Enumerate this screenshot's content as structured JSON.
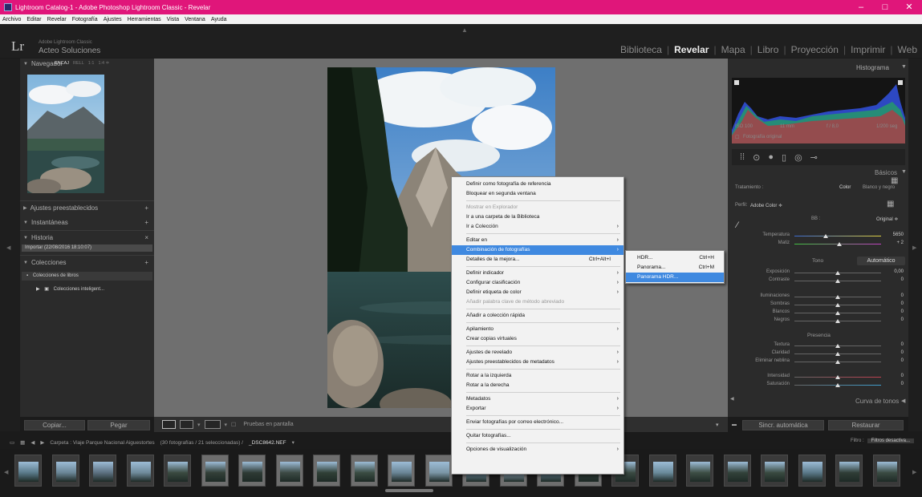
{
  "window": {
    "title": "Lightroom Catalog-1 - Adobe Photoshop Lightroom Classic - Revelar",
    "controls": [
      "–",
      "□",
      "✕"
    ]
  },
  "menubar": [
    "Archivo",
    "Editar",
    "Revelar",
    "Fotografía",
    "Ajustes",
    "Herramientas",
    "Vista",
    "Ventana",
    "Ayuda"
  ],
  "identity": {
    "logo": "Lr",
    "subtitle": "Adobe Lightroom Classic",
    "name": "Acteo Soluciones"
  },
  "modules": [
    "Biblioteca",
    "Revelar",
    "Mapa",
    "Libro",
    "Proyección",
    "Imprimir",
    "Web"
  ],
  "active_module": "Revelar",
  "left_panel": {
    "navigator_title": "Navegador",
    "navigator_options": [
      "ENCAJ",
      "RELL",
      "1:1",
      "1:4 ≑"
    ],
    "presets": "Ajustes preestablecidos",
    "snapshots": "Instantáneas",
    "history": "Historia",
    "history_item": "Importar (22/08/2016 18:10:07)",
    "collections": "Colecciones",
    "collection_set": "Colecciones de libros",
    "smart_collections": "Colecciones inteligent...",
    "copy_button": "Copiar...",
    "paste_button": "Pegar"
  },
  "right_panel": {
    "histogram_title": "Histograma",
    "exif": [
      "ISO 100",
      "11 mm",
      "f / 8,0",
      "1/200 seg"
    ],
    "original_photo": "Fotografía original",
    "basics_title": "Básicos",
    "treatment_label": "Tratamiento :",
    "treatment_options": [
      "Color",
      "Blanco y negro"
    ],
    "profile_label": "Perfil:",
    "profile_value": "Adobe Color ≑",
    "wb_label": "BB :",
    "wb_value": "Original ≑",
    "temp_label": "Temperatura",
    "temp_value": "5650",
    "tint_label": "Matiz",
    "tint_value": "+ 2",
    "tone_label": "Tono",
    "auto_button": "Automático",
    "exposure_label": "Exposición",
    "exposure_value": "0,00",
    "contrast_label": "Contraste",
    "contrast_value": "0",
    "highlights_label": "Iluminaciones",
    "highlights_value": "0",
    "shadows_label": "Sombras",
    "shadows_value": "0",
    "whites_label": "Blancos",
    "whites_value": "0",
    "blacks_label": "Negros",
    "blacks_value": "0",
    "presence_label": "Presencia",
    "texture_label": "Textura",
    "texture_value": "0",
    "clarity_label": "Claridad",
    "clarity_value": "0",
    "dehaze_label": "Eliminar neblina",
    "dehaze_value": "0",
    "vibrance_label": "Intensidad",
    "vibrance_value": "0",
    "saturation_label": "Saturación",
    "saturation_value": "0",
    "tone_curve_title": "Curva de tonos",
    "sync_button": "Sincr. automática",
    "reset_button": "Restaurar"
  },
  "toolbar": {
    "proof_label": "Pruebas en pantalla"
  },
  "filmstrip": {
    "path_prefix": "Carpeta : Viaje Parque Nacional Aiguestortes",
    "count": "(30 fotografías / 21 seleccionadas) /",
    "filename": "_DSC8642.NEF",
    "filter_label": "Filtro :",
    "filter_value": "Filtros desactiva...",
    "thumbs": [
      {
        "sel": false,
        "tone": "#5a7a8a"
      },
      {
        "sel": false,
        "tone": "#6a8595"
      },
      {
        "sel": false,
        "tone": "#5c7080"
      },
      {
        "sel": false,
        "tone": "#6f8a9a"
      },
      {
        "sel": false,
        "tone": "#3a4a40"
      },
      {
        "sel": true,
        "tone": "#334038"
      },
      {
        "sel": true,
        "tone": "#2e3a34"
      },
      {
        "sel": true,
        "tone": "#3c4a44"
      },
      {
        "sel": true,
        "tone": "#304036"
      },
      {
        "sel": true,
        "tone": "#3a4c42"
      },
      {
        "sel": true,
        "tone": "#6a8595"
      },
      {
        "sel": true,
        "tone": "#7a95a5"
      },
      {
        "sel": true,
        "tone": "#6c8a9a"
      },
      {
        "sel": true,
        "tone": "#8aa0b0"
      },
      {
        "sel": true,
        "tone": "#5f7a88"
      },
      {
        "sel": true,
        "tone": "#2f3c36"
      },
      {
        "sel": false,
        "tone": "#3a4a42"
      },
      {
        "sel": false,
        "tone": "#6a8a9a"
      },
      {
        "sel": false,
        "tone": "#3d4e44"
      },
      {
        "sel": false,
        "tone": "#32423a"
      },
      {
        "sel": false,
        "tone": "#394a40"
      },
      {
        "sel": false,
        "tone": "#5a7888"
      },
      {
        "sel": false,
        "tone": "#2f3d36"
      },
      {
        "sel": false,
        "tone": "#3a4b42"
      }
    ]
  },
  "context_menu": [
    {
      "label": "Definir como fotografía de referencia"
    },
    {
      "label": "Bloquear en segunda ventana"
    },
    {
      "sep": true
    },
    {
      "label": "Mostrar en Explorador",
      "disabled": true
    },
    {
      "label": "Ir a una carpeta de la Biblioteca"
    },
    {
      "label": "Ir a Colección",
      "arrow": true
    },
    {
      "sep": true
    },
    {
      "label": "Editar en",
      "arrow": true
    },
    {
      "label": "Combinación de fotografías",
      "arrow": true,
      "highlight": true
    },
    {
      "label": "Detalles de la mejora...",
      "shortcut": "Ctrl+Alt+I"
    },
    {
      "sep": true
    },
    {
      "label": "Definir indicador",
      "arrow": true
    },
    {
      "label": "Configurar clasificación",
      "arrow": true
    },
    {
      "label": "Definir etiqueta de color",
      "arrow": true
    },
    {
      "label": "Añadir palabra clave de método abreviado",
      "disabled": true
    },
    {
      "sep": true
    },
    {
      "label": "Añadir a colección rápida"
    },
    {
      "sep": true
    },
    {
      "label": "Apilamiento",
      "arrow": true
    },
    {
      "label": "Crear copias virtuales"
    },
    {
      "sep": true
    },
    {
      "label": "Ajustes de revelado",
      "arrow": true
    },
    {
      "label": "Ajustes preestablecidos de metadatos",
      "arrow": true
    },
    {
      "sep": true
    },
    {
      "label": "Rotar a la izquierda"
    },
    {
      "label": "Rotar a la derecha"
    },
    {
      "sep": true
    },
    {
      "label": "Metadatos",
      "arrow": true
    },
    {
      "label": "Exportar",
      "arrow": true
    },
    {
      "sep": true
    },
    {
      "label": "Enviar fotografías por correo electrónico..."
    },
    {
      "sep": true
    },
    {
      "label": "Quitar fotografías..."
    },
    {
      "sep": true
    },
    {
      "label": "Opciones de visualización",
      "arrow": true
    }
  ],
  "submenu": [
    {
      "label": "HDR...",
      "shortcut": "Ctrl+H"
    },
    {
      "label": "Panorama...",
      "shortcut": "Ctrl+M"
    },
    {
      "label": "Panorama HDR...",
      "highlight": true
    }
  ],
  "colors": {
    "title_bar": "#e0167a",
    "highlight": "#3f89e0",
    "panel_bg": "#2b2b2b",
    "canvas_bg": "#6f6f6f"
  }
}
